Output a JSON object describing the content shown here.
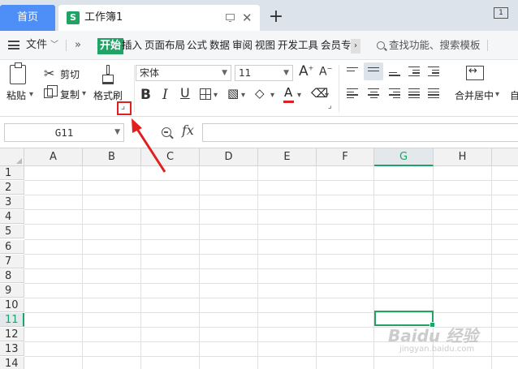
{
  "tabs": {
    "home": "首页",
    "doc_icon": "S",
    "doc_title": "工作簿1",
    "add": "+",
    "window_badge": "1"
  },
  "menu": {
    "file": "文件",
    "more": "»",
    "items": [
      "开始",
      "插入",
      "页面布局",
      "公式",
      "数据",
      "审阅",
      "视图",
      "开发工具",
      "会员专"
    ],
    "scroll_arrow": "›",
    "search": "查找功能、搜索模板"
  },
  "toolbar": {
    "paste": "粘贴",
    "cut": "剪切",
    "copy": "复制",
    "format_painter": "格式刷",
    "font_name": "宋体",
    "font_size": "11",
    "bold": "B",
    "italic": "I",
    "underline": "U",
    "font_color_glyph": "A",
    "font_color": "#e02020",
    "merge_center": "合并居中",
    "auto_wrap": "自"
  },
  "formula_bar": {
    "name_box": "G11",
    "fx": "fx",
    "formula": ""
  },
  "grid": {
    "columns": [
      "A",
      "B",
      "C",
      "D",
      "E",
      "F",
      "G",
      "H"
    ],
    "rows": [
      "1",
      "2",
      "3",
      "4",
      "5",
      "6",
      "7",
      "8",
      "9",
      "10",
      "11",
      "12",
      "13",
      "14"
    ],
    "selected_column": "G",
    "selected_row": "11",
    "accent": "#21a366"
  },
  "watermark": {
    "brand": "Baidu 经验",
    "url": "jingyan.baidu.com"
  }
}
